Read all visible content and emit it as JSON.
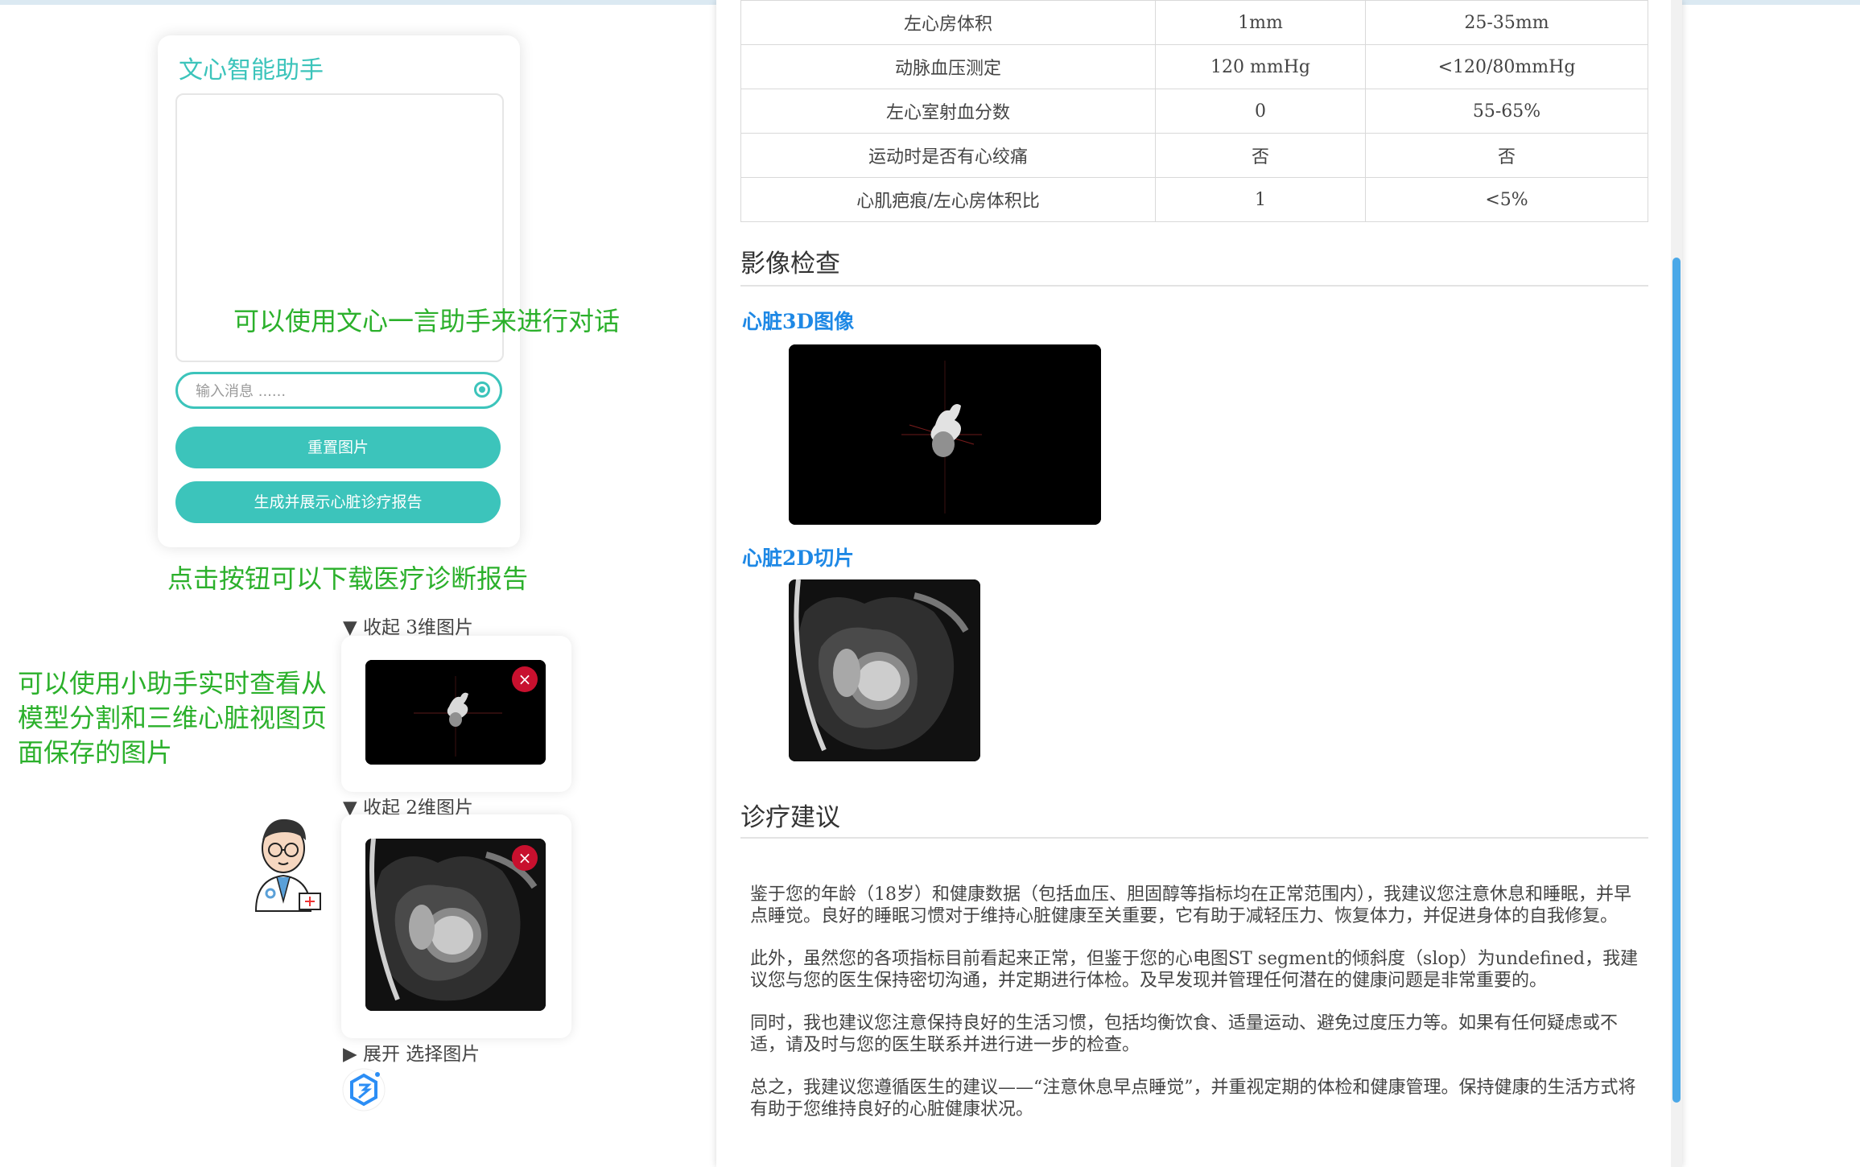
{
  "assistant": {
    "title": "文心智能助手",
    "input_placeholder": "输入消息 ......",
    "reset_button": "重置图片",
    "report_button": "生成并展示心脏诊疗报告"
  },
  "annotations": {
    "chat_hint": "可以使用文心一言助手来进行对话",
    "download_hint": "点击按钮可以下载医疗诊断报告",
    "view_hint": "可以使用小助手实时查看从模型分割和三维心脏视图页面保存的图片"
  },
  "gallery": {
    "toggle_3d": "▼ 收起  3维图片",
    "toggle_2d": "▼ 收起  2维图片",
    "toggle_select": "▶ 展开  选择图片",
    "close_label": "×"
  },
  "metrics_table": {
    "rows": [
      [
        "左心房体积",
        "1mm",
        "25-35mm"
      ],
      [
        "动脉血压测定",
        "120 mmHg",
        "<120/80mmHg"
      ],
      [
        "左心室射血分数",
        "0",
        "55-65%"
      ],
      [
        "运动时是否有心绞痛",
        "否",
        "否"
      ],
      [
        "心肌疤痕/左心房体积比",
        "1",
        "<5%"
      ]
    ]
  },
  "imaging": {
    "title": "影像检查",
    "heart_3d_label": "心脏3D图像",
    "heart_2d_label": "心脏2D切片"
  },
  "advice": {
    "title": "诊疗建议",
    "paragraphs": [
      "鉴于您的年龄（18岁）和健康数据（包括血压、胆固醇等指标均在正常范围内），我建议您注意休息和睡眠，并早点睡觉。良好的睡眠习惯对于维持心脏健康至关重要，它有助于减轻压力、恢复体力，并促进身体的自我修复。",
      "此外，虽然您的各项指标目前看起来正常，但鉴于您的心电图ST segment的倾斜度（slop）为undefined，我建议您与您的医生保持密切沟通，并定期进行体检。及早发现并管理任何潜在的健康问题是非常重要的。",
      "同时，我也建议您注意保持良好的生活习惯，包括均衡饮食、适量运动、避免过度压力等。如果有任何疑虑或不适，请及时与您的医生联系并进行进一步的检查。",
      "总之，我建议您遵循医生的建议——“注意休息早点睡觉”，并重视定期的体检和健康管理。保持健康的生活方式将有助于您维持良好的心脏健康状况。"
    ]
  },
  "colors": {
    "accent": "#3cc4bb",
    "annotation": "#2bb02b",
    "link_blue": "#1e88e5",
    "close_red": "#c8102e"
  }
}
